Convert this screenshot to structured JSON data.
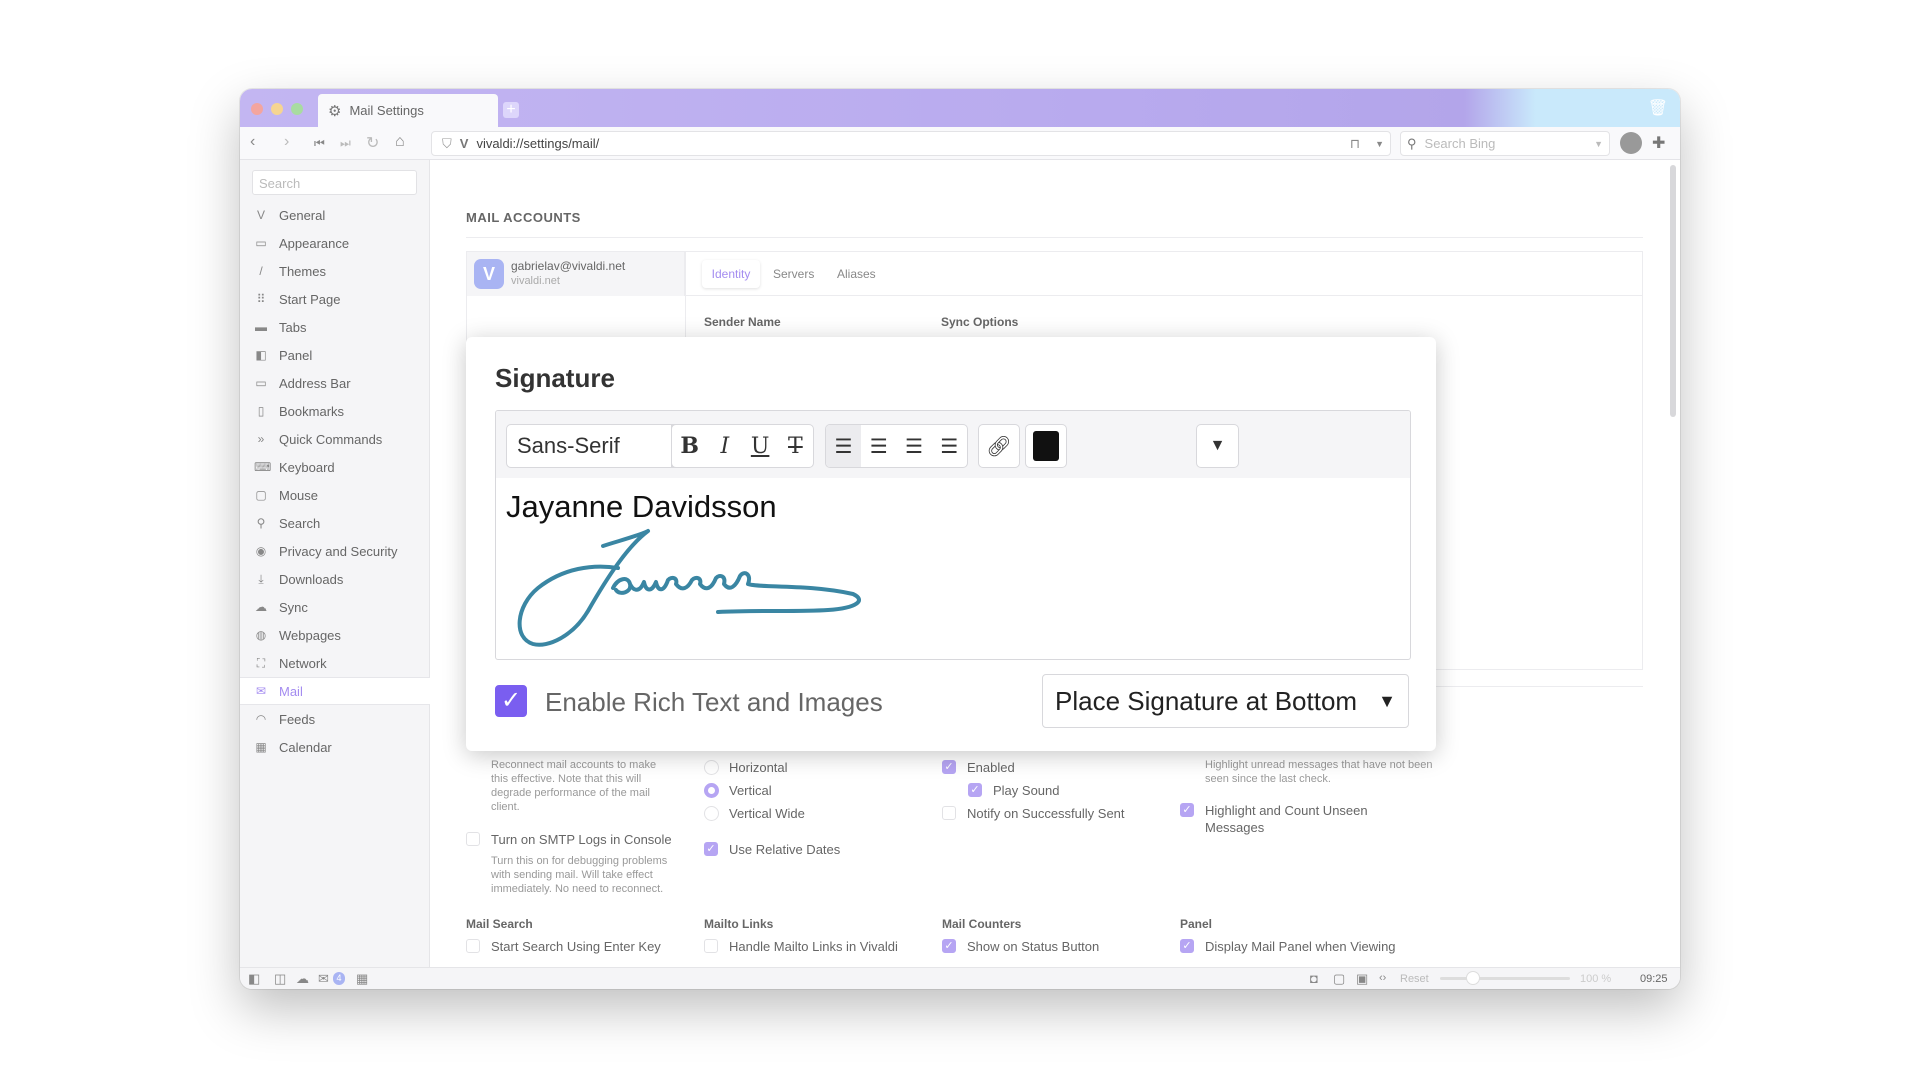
{
  "window": {
    "tab_title": "Mail Settings",
    "url": "vivaldi://settings/mail/",
    "search_placeholder": "Search Bing",
    "traffic_lights": [
      "#f3a59f",
      "#f6d591",
      "#a8dca0"
    ]
  },
  "sidebar": {
    "search_placeholder": "Search",
    "active": "Mail",
    "items": [
      {
        "label": "General",
        "icon": "V"
      },
      {
        "label": "Appearance",
        "icon": "▭"
      },
      {
        "label": "Themes",
        "icon": "/"
      },
      {
        "label": "Start Page",
        "icon": "⠿"
      },
      {
        "label": "Tabs",
        "icon": "▬"
      },
      {
        "label": "Panel",
        "icon": "◧"
      },
      {
        "label": "Address Bar",
        "icon": "▭"
      },
      {
        "label": "Bookmarks",
        "icon": "▯"
      },
      {
        "label": "Quick Commands",
        "icon": "»"
      },
      {
        "label": "Keyboard",
        "icon": "⌨"
      },
      {
        "label": "Mouse",
        "icon": "▢"
      },
      {
        "label": "Search",
        "icon": "⚲"
      },
      {
        "label": "Privacy and Security",
        "icon": "◉"
      },
      {
        "label": "Downloads",
        "icon": "⤓"
      },
      {
        "label": "Sync",
        "icon": "☁"
      },
      {
        "label": "Webpages",
        "icon": "◍"
      },
      {
        "label": "Network",
        "icon": "⛶"
      },
      {
        "label": "Mail",
        "icon": "✉"
      },
      {
        "label": "Feeds",
        "icon": "◠"
      },
      {
        "label": "Calendar",
        "icon": "▦"
      }
    ]
  },
  "main": {
    "section_title": "MAIL ACCOUNTS",
    "account": {
      "email": "gabrielav@vivaldi.net",
      "domain": "vivaldi.net"
    },
    "tabs": [
      {
        "label": "Identity",
        "active": true
      },
      {
        "label": "Servers"
      },
      {
        "label": "Aliases"
      }
    ],
    "sender_name_label": "Sender Name",
    "sync_options_label": "Sync Options",
    "col1": {
      "desc": "Reconnect mail accounts to make this effective. Note that this will degrade performance of the mail client.",
      "smtp_label": "Turn on SMTP Logs in Console",
      "smtp_checked": false,
      "smtp_desc": "Turn this on for debugging problems with sending mail. Will take effect immediately. No need to reconnect."
    },
    "col2": {
      "options": [
        "Horizontal",
        "Vertical",
        "Vertical Wide"
      ],
      "selected": "Vertical",
      "relative_dates": "Use Relative Dates",
      "relative_dates_checked": true
    },
    "col3": {
      "enabled": "Enabled",
      "enabled_checked": true,
      "play_sound": "Play Sound",
      "play_sound_checked": true,
      "notify_sent": "Notify on Successfully Sent",
      "notify_sent_checked": false
    },
    "col4": {
      "desc": "Highlight unread messages that have not been seen since the last check.",
      "highlight": "Highlight and Count Unseen Messages",
      "highlight_checked": true
    },
    "bottom": [
      {
        "title": "Mail Search",
        "item": "Start Search Using Enter Key",
        "checked": false
      },
      {
        "title": "Mailto Links",
        "item": "Handle Mailto Links in Vivaldi",
        "checked": false
      },
      {
        "title": "Mail Counters",
        "item": "Show on Status Button",
        "checked": true
      },
      {
        "title": "Panel",
        "item": "Display Mail Panel when Viewing",
        "checked": true
      }
    ]
  },
  "modal": {
    "title": "Signature",
    "font": "Sans-Serif",
    "text_color": "#111111",
    "signature_name": "Jayanne Davidsson",
    "signature_image_color": "#3a86a3",
    "rich_text_label": "Enable Rich Text and Images",
    "rich_text_checked": true,
    "placement": "Place Signature at Bottom"
  },
  "status": {
    "reset": "Reset",
    "zoom": "100 %",
    "time": "09:25",
    "mail_badge": "4",
    "zoom_level": 100
  },
  "accent": "#a48cf0"
}
